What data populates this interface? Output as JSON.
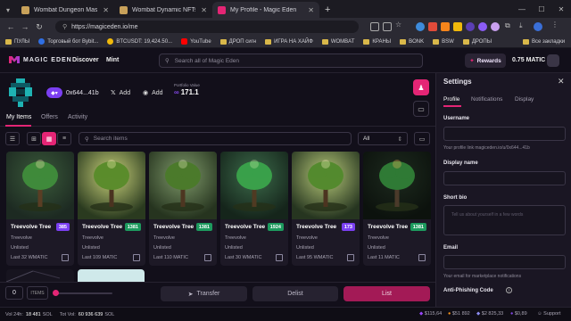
{
  "browser": {
    "tabs": [
      {
        "title": "Wombat Dungeon Master",
        "active": false,
        "color": "#c8a15a"
      },
      {
        "title": "Wombat Dynamic NFTs",
        "active": false,
        "color": "#c8a15a"
      },
      {
        "title": "My Profile - Magic Eden",
        "active": true,
        "color": "#e42575"
      }
    ],
    "url": "https://magiceden.io/me",
    "bookmarks": [
      {
        "label": "ПУЛЫ",
        "type": "folder"
      },
      {
        "label": "Торговый бот Bybit...",
        "type": "dot",
        "color": "#2f6fe4"
      },
      {
        "label": "BTCUSDT: 19,424.50...",
        "type": "dot",
        "color": "#f0b90b"
      },
      {
        "label": "YouTube",
        "type": "dot",
        "color": "#ff0000"
      },
      {
        "label": "ДРОП сигн",
        "type": "folder"
      },
      {
        "label": "ИГРА НА ХАЙФ",
        "type": "folder"
      },
      {
        "label": "WOMBAT",
        "type": "folder"
      },
      {
        "label": "КРАНЫ",
        "type": "folder"
      },
      {
        "label": "BONK",
        "type": "folder"
      },
      {
        "label": "BSW",
        "type": "folder"
      },
      {
        "label": "ДРОПЫ",
        "type": "folder"
      }
    ],
    "all_bookmarks": "Все закладки"
  },
  "site": {
    "logo": "MAGIC EDEN",
    "nav": [
      "Discover",
      "Mint"
    ],
    "search_placeholder": "Search all of Magic Eden",
    "rewards": "Rewards",
    "balance": "0.75 MATIC"
  },
  "profile": {
    "wallet": "0x644...41b",
    "follow_x": "Add",
    "follow_discord": "Add",
    "portfolio_label": "Portfolio Value",
    "portfolio_value": "171.1",
    "tabs": [
      "My Items",
      "Offers",
      "Activity"
    ],
    "items_search_placeholder": "Search items",
    "filter_value": "All"
  },
  "items": [
    {
      "name": "Treevolve Tree",
      "rank": "385",
      "rank_color": "#7b3ff2",
      "collection": "Treevolve",
      "status": "Unlisted",
      "last": "Last 32 WMATIC",
      "scene": 0
    },
    {
      "name": "Treevolve Tree",
      "rank": "1381",
      "rank_color": "#1d9a5e",
      "collection": "Treevolve",
      "status": "Unlisted",
      "last": "Last 109 MATIC",
      "scene": 1
    },
    {
      "name": "Treevolve Tree",
      "rank": "1381",
      "rank_color": "#1d9a5e",
      "collection": "Treevolve",
      "status": "Unlisted",
      "last": "Last 110 MATIC",
      "scene": 2
    },
    {
      "name": "Treevolve Tree",
      "rank": "1924",
      "rank_color": "#1d9a5e",
      "collection": "Treevolve",
      "status": "Unlisted",
      "last": "Last 30 WMATIC",
      "scene": 3
    },
    {
      "name": "Treevolve Tree",
      "rank": "173",
      "rank_color": "#7b3ff2",
      "collection": "Treevolve",
      "status": "Unlisted",
      "last": "Last 95 WMATIC",
      "scene": 4
    },
    {
      "name": "Treevolve Tree",
      "rank": "1381",
      "rank_color": "#1d9a5e",
      "collection": "Treevolve",
      "status": "Unlisted",
      "last": "Last 11 MATIC",
      "scene": 5
    }
  ],
  "bottom": {
    "count": "0",
    "items_label": "ITEMS",
    "transfer": "Transfer",
    "delist": "Delist",
    "list": "List"
  },
  "status": {
    "vol24": "Vol 24h:",
    "vol24_value": "18 481",
    "vol24_unit": "SOL",
    "totvol": "Tot Vol:",
    "totvol_value": "60 936 639",
    "totvol_unit": "SOL",
    "prices": [
      "$115,64",
      "$51 892",
      "$2 825,33",
      "$0,89"
    ],
    "support": "Support"
  },
  "settings": {
    "title": "Settings",
    "tabs": [
      "Profile",
      "Notifications",
      "Display"
    ],
    "username_label": "Username",
    "profile_link": "Your profile link magiceden.io/u/0x644...41b",
    "display_name_label": "Display name",
    "short_bio_label": "Short bio",
    "bio_placeholder": "Tell us about yourself in a few words",
    "email_label": "Email",
    "email_hint": "Your email for marketplace notifications",
    "anti_phishing_label": "Anti-Phishing Code"
  }
}
